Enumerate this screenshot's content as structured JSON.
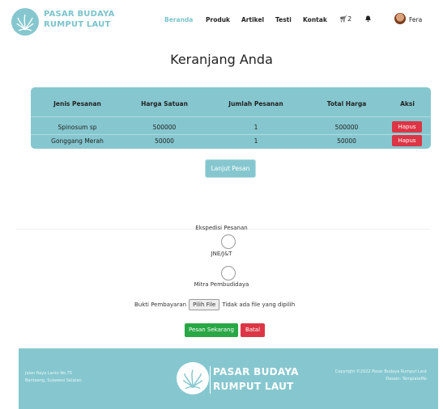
{
  "brand": {
    "line1": "PASAR BUDAYA",
    "line2": "RUMPUT LAUT",
    "logo_icon": "seaweed-logo-icon"
  },
  "nav": {
    "items": [
      {
        "label": "Beranda",
        "active": true
      },
      {
        "label": "Produk",
        "active": false
      },
      {
        "label": "Artikel",
        "active": false
      },
      {
        "label": "Testi",
        "active": false
      },
      {
        "label": "Kontak",
        "active": false
      }
    ],
    "cart_count": "2",
    "user_name": "Fera"
  },
  "page_title": "Keranjang Anda",
  "cart": {
    "headers": [
      "Jenis Pesanan",
      "Harga Satuan",
      "Jumlah Pesanan",
      "Total Harga",
      "Aksi"
    ],
    "rows": [
      {
        "name": "Spinosum sp",
        "price": "500000",
        "qty": "1",
        "total": "500000",
        "action": "Hapus"
      },
      {
        "name": "Gonggang Merah",
        "price": "50000",
        "qty": "1",
        "total": "50000",
        "action": "Hapus"
      }
    ]
  },
  "continue_label": "Lanjut Pesan",
  "shipping": {
    "title": "Ekspedisi Pesanan",
    "options": [
      {
        "label": "JNE/J&T"
      },
      {
        "label": "Mitra Pembudidaya"
      }
    ]
  },
  "upload": {
    "label": "Bukti Pembayaran",
    "button": "Pilih File",
    "status": "Tidak ada file yang dipilih"
  },
  "actions": {
    "order": "Pesan Sekarang",
    "cancel": "Batal"
  },
  "footer": {
    "address_line1": "Jalan Raya Lanto No.75",
    "address_line2": "Bantaeng, Sulawesi Selatan",
    "brand_line1": "PASAR BUDAYA",
    "brand_line2": "RUMPUT LAUT",
    "copyright": "Copyright ©2022 Pasar Budaya Rumput Laut",
    "design": "Desain: TemplateMo"
  },
  "colors": {
    "accent": "#86c7cf",
    "danger": "#dc3545",
    "success": "#28a745"
  }
}
